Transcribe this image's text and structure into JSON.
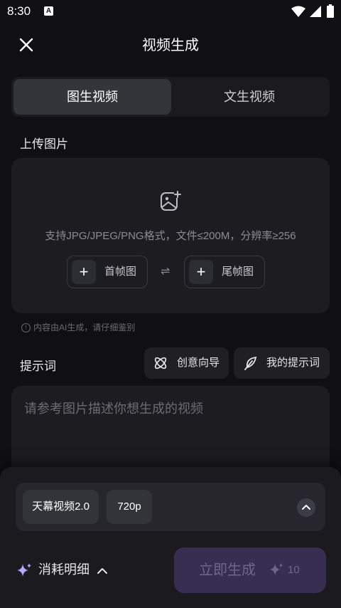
{
  "status_bar": {
    "time": "8:30",
    "notification_icon": "A"
  },
  "header": {
    "title": "视频生成",
    "close_icon": "close-icon"
  },
  "tabs": [
    {
      "label": "图生视频",
      "active": true
    },
    {
      "label": "文生视频",
      "active": false
    }
  ],
  "upload": {
    "section_label": "上传图片",
    "hint": "支持JPG/JPEG/PNG格式，文件≤200M，分辨率≥256",
    "first_frame": "首帧图",
    "last_frame": "尾帧图",
    "swap_symbol": "⇌",
    "plus_symbol": "+"
  },
  "notice": "内容由AI生成，请仔细鉴别",
  "prompt": {
    "section_label": "提示词",
    "creative_guide": "创意向导",
    "my_prompts": "我的提示词",
    "placeholder": "请参考图片描述你想生成的视频"
  },
  "bottom": {
    "model": "天幕视频2.0",
    "resolution": "720p",
    "cost_detail": "消耗明细",
    "generate": "立即生成",
    "generate_cost": "10"
  },
  "colors": {
    "accent_disabled": "#372e52",
    "background": "#101012",
    "card": "#1c1c21"
  }
}
